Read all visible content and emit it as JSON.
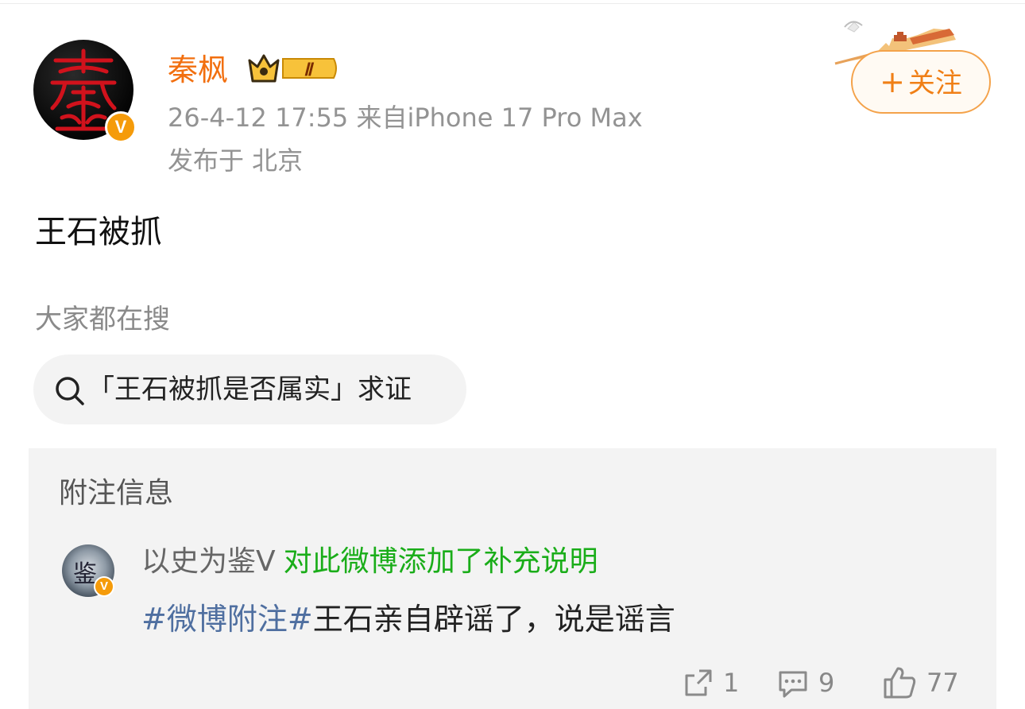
{
  "post": {
    "author": {
      "name": "秦枫",
      "verified_badge": "V",
      "level_badge": "Ⅱ",
      "avatar_icon": "seal-qin-avatar"
    },
    "meta": {
      "time_source": "26-4-12 17:55  来自iPhone 17 Pro Max",
      "location": "发布于 北京"
    },
    "follow_button": {
      "plus": "+",
      "label": "关注"
    },
    "text": "王石被抓"
  },
  "search": {
    "label": "大家都在搜",
    "query": "「王石被抓是否属实」求证"
  },
  "note": {
    "title": "附注信息",
    "author": "以史为鉴Ⅴ",
    "author_avatar_glyph": "鉴",
    "action": "对此微博添加了补充说明",
    "hashtag": "#微博附注#",
    "content": "王石亲自辟谣了，说是谣言"
  },
  "actions": {
    "share_count": "1",
    "comment_count": "9",
    "like_count": "77"
  },
  "colors": {
    "username": "#f26f0f",
    "follow": "#f07f16",
    "note_action": "#1aad19",
    "hashtag": "#4f6fa0"
  }
}
